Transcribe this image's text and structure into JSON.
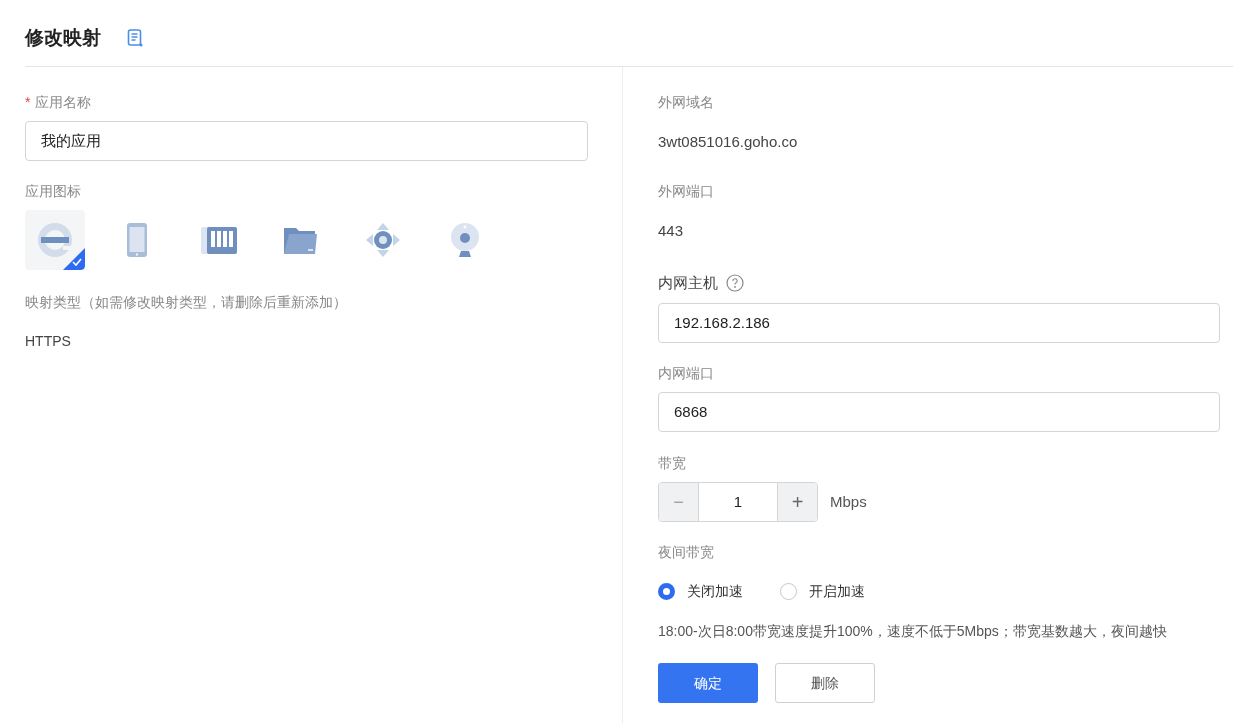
{
  "header": {
    "title": "修改映射"
  },
  "left": {
    "name_label": {
      "required_mark": "*",
      "text": "应用名称"
    },
    "name_value": "我的应用",
    "icon_label": "应用图标",
    "icons": [
      {
        "kind": "browser",
        "selected": true
      },
      {
        "kind": "tablet",
        "selected": false
      },
      {
        "kind": "server",
        "selected": false
      },
      {
        "kind": "folder",
        "selected": false
      },
      {
        "kind": "arrows",
        "selected": false
      },
      {
        "kind": "webcam",
        "selected": false
      }
    ],
    "type_label": "映射类型（如需修改映射类型，请删除后重新添加）",
    "type_value": "HTTPS"
  },
  "right": {
    "domain_label": "外网域名",
    "domain_value": "3wt0851016.goho.co",
    "port_label": "外网端口",
    "port_value": "443",
    "host_label": "内网主机",
    "host_value": "192.168.2.186",
    "lan_port_label": "内网端口",
    "lan_port_value": "6868",
    "bandwidth_label": "带宽",
    "bandwidth": {
      "minus": "−",
      "value": "1",
      "plus": "+",
      "disabled_minus": true,
      "unit": "Mbps"
    },
    "night_label": "夜间带宽",
    "night_options": [
      {
        "label": "关闭加速",
        "selected": true
      },
      {
        "label": "开启加速",
        "selected": false
      }
    ],
    "night_note": "18:00-次日8:00带宽速度提升100%，速度不低于5Mbps；带宽基数越大，夜间越快",
    "buttons": [
      {
        "label": "确定",
        "kind": "primary"
      },
      {
        "label": "删除",
        "kind": "secondary"
      }
    ]
  }
}
